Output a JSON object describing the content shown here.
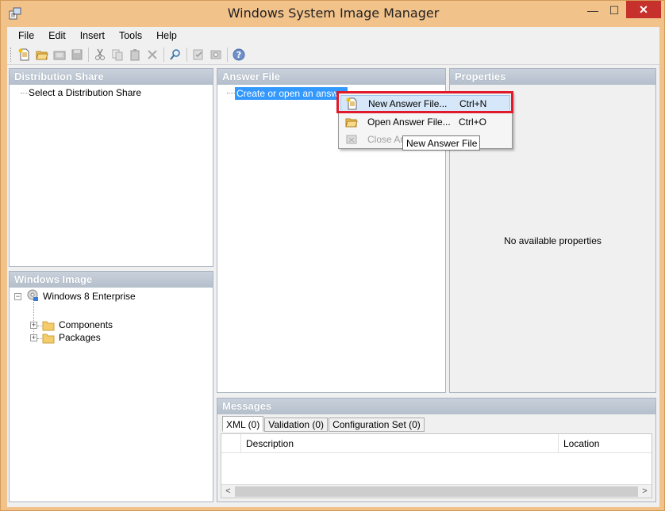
{
  "window": {
    "title": "Windows System Image Manager",
    "controls": {
      "minimize": "—",
      "maximize": "☐",
      "close": "✕"
    }
  },
  "menu": [
    "File",
    "Edit",
    "Insert",
    "Tools",
    "Help"
  ],
  "toolbar": {
    "buttons": [
      "new-icon",
      "open-icon",
      "open-image-icon",
      "save-icon",
      "cut-icon",
      "copy-icon",
      "paste-icon",
      "delete-icon",
      "find-icon",
      "validate-icon",
      "config-set-icon",
      "help-icon"
    ]
  },
  "distribution_share": {
    "header": "Distribution Share",
    "node": "Select a Distribution Share"
  },
  "windows_image": {
    "header": "Windows Image",
    "root": "Windows 8 Enterprise",
    "children": [
      "Components",
      "Packages"
    ]
  },
  "answer_file": {
    "header": "Answer File",
    "node": "Create or open an answer fi"
  },
  "properties": {
    "header": "Properties",
    "empty_text": "No available properties"
  },
  "context_menu": {
    "items": [
      {
        "label": "New Answer File...",
        "shortcut": "Ctrl+N"
      },
      {
        "label": "Open Answer File...",
        "shortcut": "Ctrl+O"
      },
      {
        "label": "Close An",
        "shortcut": ""
      }
    ]
  },
  "tooltip": "New Answer File",
  "messages": {
    "header": "Messages",
    "tabs": [
      "XML (0)",
      "Validation (0)",
      "Configuration Set (0)"
    ],
    "columns": [
      "Description",
      "Location"
    ]
  },
  "colors": {
    "highlight_box": "#e01a2b",
    "selection": "#3399ff",
    "frame": "#f2c28b"
  }
}
